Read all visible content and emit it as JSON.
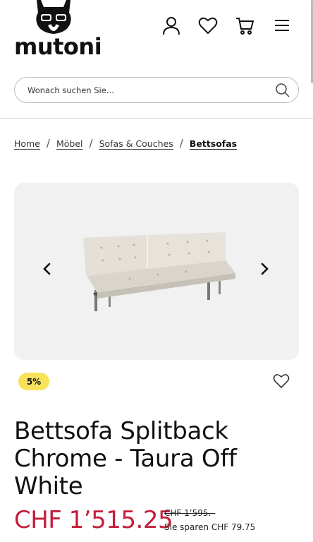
{
  "header": {
    "logo_text": "mutoni",
    "search": {
      "placeholder": "Wonach suchen Sie..."
    },
    "icons": [
      "user-icon",
      "heart-icon",
      "cart-icon",
      "menu-icon"
    ]
  },
  "breadcrumb": {
    "items": [
      "Home",
      "Möbel",
      "Sofas & Couches",
      "Bettsofas"
    ],
    "separator": "/"
  },
  "product": {
    "discount_badge": "5%",
    "title": "Bettsofa Splitback Chrome - Taura Off White",
    "price": "CHF 1’515.25",
    "old_price": "CHF 1’595.–",
    "savings": "Sie sparen CHF 79.75"
  },
  "colors": {
    "price": "#c41e3a",
    "badge": "#f7e25a",
    "gallery_bg": "#f1f1f1"
  }
}
